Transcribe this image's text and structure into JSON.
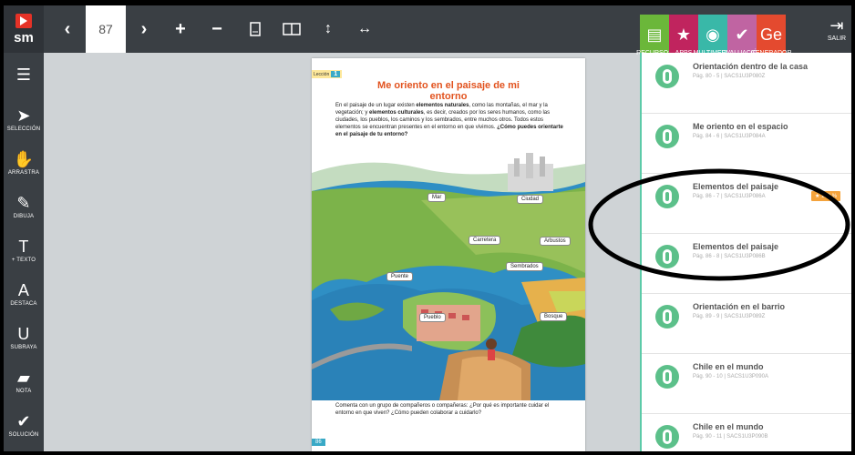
{
  "app": {
    "logo_text": "sm"
  },
  "toolbar": {
    "page_number": "87",
    "prev_icon": "‹",
    "next_icon": "›",
    "plus_icon": "+",
    "minus_icon": "−",
    "vertical_icon": "↕",
    "horizontal_icon": "↔"
  },
  "resources": [
    {
      "label": "RECURSOS",
      "color": "#6bb73a",
      "icon": "▤"
    },
    {
      "label": "APPS",
      "color": "#c0245e",
      "icon": "★"
    },
    {
      "label": "MULTIMEDIA",
      "color": "#39b8a8",
      "icon": "◉"
    },
    {
      "label": "EVALUACIÓN",
      "color": "#c064a2",
      "icon": "✔"
    },
    {
      "label": "GENERADOR",
      "color": "#e44a2f",
      "icon": "Ge"
    }
  ],
  "salir": {
    "label": "SALIR",
    "icon": "⇥"
  },
  "left_tools": [
    {
      "label": "",
      "icon": "☰"
    },
    {
      "label": "SELECCIÓN",
      "icon": "➤"
    },
    {
      "label": "ARRASTRA",
      "icon": "✋"
    },
    {
      "label": "DIBUJA",
      "icon": "✎"
    },
    {
      "label": "+ TEXTO",
      "icon": "T"
    },
    {
      "label": "DESTACA",
      "icon": "A"
    },
    {
      "label": "SUBRAYA",
      "icon": "U"
    },
    {
      "label": "NOTA",
      "icon": "▰"
    },
    {
      "label": "SOLUCIÓN",
      "icon": "✔"
    }
  ],
  "page": {
    "lesson_label": "Lección",
    "lesson_number": "1",
    "title": "Me oriento en el paisaje de mi entorno",
    "text1": "En el paisaje de un lugar existen",
    "text1b": "elementos naturales",
    "text1c": ", como las montañas, el mar y la vegetación; y",
    "text1d": "elementos culturales",
    "text1e": ", es decir, creados por los seres humanos, como las ciudades, los pueblos, los caminos y los sembrados, entre muchos otros. Todos estos elementos se encuentran presentes en el entorno en que vivimos.",
    "question": "¿Cómo puedes orientarte en el paisaje de tu entorno?",
    "labels": [
      "Mar",
      "Ciudad",
      "Carretera",
      "Arbustos",
      "Sembrados",
      "Puente",
      "Pueblo",
      "Bosque"
    ],
    "footer": "Comenta con un grupo de compañeros o compañeras: ¿Por qué es importante cuidar el entorno en que viven? ¿Cómo pueden colaborar a cuidarlo?",
    "page_num": "86"
  },
  "panel_items": [
    {
      "title": "Orientación dentro de la casa",
      "sub": "Pág. 80 - 5 | SACS1U3P080Z",
      "badge": ""
    },
    {
      "title": "Me oriento en el espacio",
      "sub": "Pág. 84 - 6 | SACS1U3P084A",
      "badge": ""
    },
    {
      "title": "Elementos del paisaje",
      "sub": "Pág. 86 - 7 | SACS1U3P086A",
      "badge": "★ 100 %"
    },
    {
      "title": "Elementos del paisaje",
      "sub": "Pág. 86 - 8 | SACS1U3P086B",
      "badge": ""
    },
    {
      "title": "Orientación en el barrio",
      "sub": "Pág. 89 - 9 | SACS1U3P089Z",
      "badge": ""
    },
    {
      "title": "Chile en el mundo",
      "sub": "Pág. 90 - 10 | SACS1U3P090A",
      "badge": ""
    },
    {
      "title": "Chile en el mundo",
      "sub": "Pág. 90 - 11 | SACS1U3P090B",
      "badge": ""
    }
  ]
}
